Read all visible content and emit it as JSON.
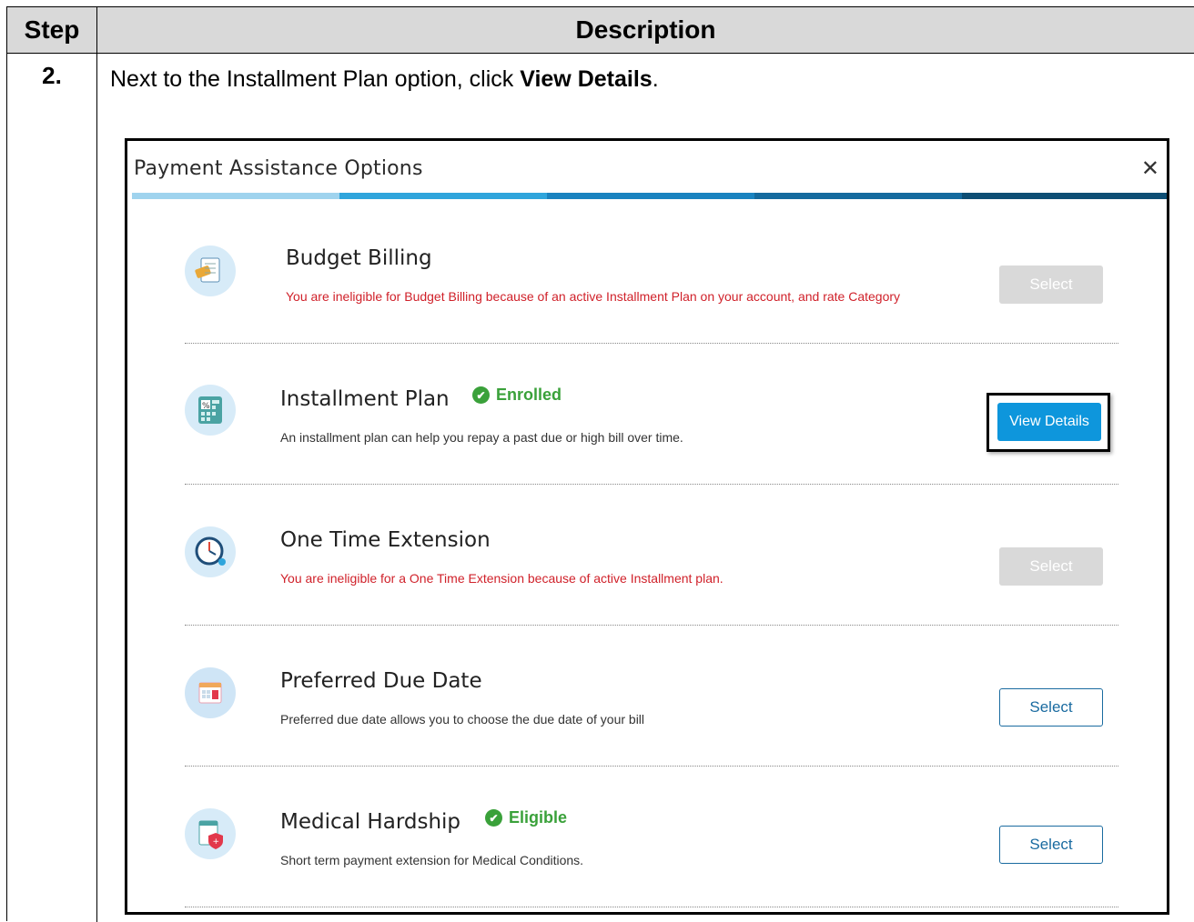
{
  "table": {
    "header_step": "Step",
    "header_description": "Description",
    "step_number": "2.",
    "instruction_before": "Next to the Installment Plan option, click ",
    "instruction_bold": "View Details",
    "instruction_after": "."
  },
  "modal": {
    "title": "Payment Assistance Options",
    "close_symbol": "✕",
    "progress_colors": [
      "#9fd3ee",
      "#2fa5dc",
      "#1a83c0",
      "#146a9e",
      "#0d4e74"
    ]
  },
  "options": [
    {
      "title": "Budget Billing",
      "description": "You are ineligible for Budget Billing because of an active Installment Plan on your account, and rate Category",
      "description_style": "error",
      "badge": "",
      "button": "Select",
      "button_state": "disabled",
      "icon": "budget-billing-icon"
    },
    {
      "title": "Installment Plan",
      "description": "An installment plan can help you repay a past due or high bill over time.",
      "description_style": "normal",
      "badge": "Enrolled",
      "button": "View Details",
      "button_state": "primary",
      "icon": "installment-plan-icon"
    },
    {
      "title": "One Time Extension",
      "description": "You are ineligible for a One Time Extension because of active Installment plan.",
      "description_style": "error",
      "badge": "",
      "button": "Select",
      "button_state": "disabled",
      "icon": "extension-clock-icon"
    },
    {
      "title": "Preferred Due Date",
      "description": "Preferred due date allows you to choose the due date of your bill",
      "description_style": "normal",
      "badge": "",
      "button": "Select",
      "button_state": "enabled",
      "icon": "calendar-icon"
    },
    {
      "title": "Medical Hardship",
      "description": "Short term payment extension for Medical Conditions.",
      "description_style": "normal",
      "badge": "Eligible",
      "button": "Select",
      "button_state": "enabled",
      "icon": "medical-icon"
    }
  ],
  "colors": {
    "badge_green": "#3aa13a",
    "error_red": "#d0212a",
    "primary_blue": "#0e96dc"
  }
}
